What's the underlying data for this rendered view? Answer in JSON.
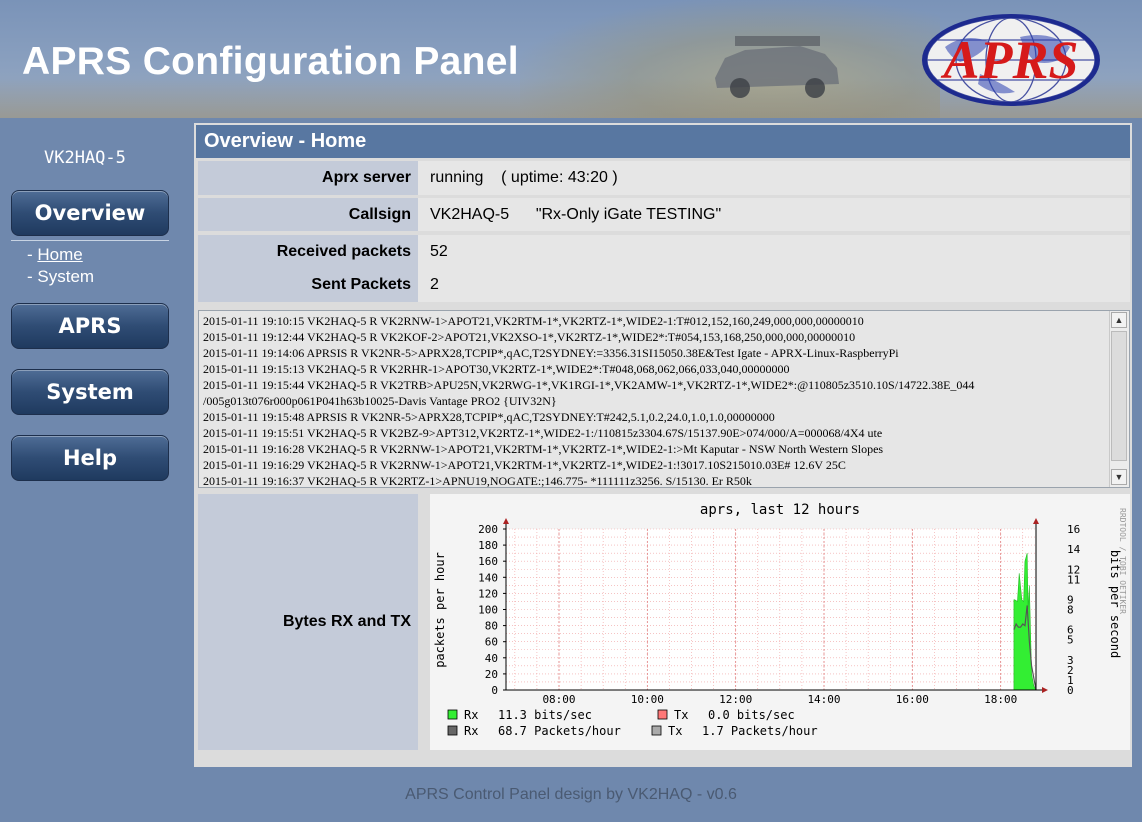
{
  "header": {
    "title": "APRS Configuration Panel",
    "logo_text": "APRS"
  },
  "sidebar": {
    "callsign": "VK2HAQ-5",
    "nav": [
      {
        "label": "Overview"
      },
      {
        "label": "APRS"
      },
      {
        "label": "System"
      },
      {
        "label": "Help"
      }
    ],
    "subnav": {
      "prefix": "- ",
      "home": "Home",
      "system": "System"
    }
  },
  "panel": {
    "title": "Overview - Home",
    "rows": {
      "server_label": "Aprx server",
      "server_value": "running    ( uptime: 43:20 )",
      "callsign_label": "Callsign",
      "callsign_value": "VK2HAQ-5      \"Rx-Only iGate TESTING\"",
      "received_label": "Received packets",
      "received_value": "52",
      "sent_label": "Sent Packets",
      "sent_value": "2"
    }
  },
  "log": [
    "2015-01-11 19:10:15 VK2HAQ-5 R VK2RNW-1>APOT21,VK2RTM-1*,VK2RTZ-1*,WIDE2-1:T#012,152,160,249,000,000,00000010",
    "2015-01-11 19:12:44 VK2HAQ-5 R VK2KOF-2>APOT21,VK2XSO-1*,VK2RTZ-1*,WIDE2*:T#054,153,168,250,000,000,00000010",
    "2015-01-11 19:14:06 APRSIS R VK2NR-5>APRX28,TCPIP*,qAC,T2SYDNEY:=3356.31SI15050.38E&Test Igate - APRX-Linux-RaspberryPi",
    "2015-01-11 19:15:13 VK2HAQ-5 R VK2RHR-1>APOT30,VK2RTZ-1*,WIDE2*:T#048,068,062,066,033,040,00000000",
    "2015-01-11 19:15:44 VK2HAQ-5 R VK2TRB>APU25N,VK2RWG-1*,VK1RGI-1*,VK2AMW-1*,VK2RTZ-1*,WIDE2*:@110805z3510.10S/14722.38E_044",
    "/005g013t076r000p061P041h63b10025-Davis Vantage PRO2 {UIV32N}",
    "2015-01-11 19:15:48 APRSIS R VK2NR-5>APRX28,TCPIP*,qAC,T2SYDNEY:T#242,5.1,0.2,24.0,1.0,1.0,00000000",
    "2015-01-11 19:15:51 VK2HAQ-5 R VK2BZ-9>APT312,VK2RTZ-1*,WIDE2-1:/110815z3304.67S/15137.90E>074/000/A=000068/4X4 ute",
    "2015-01-11 19:16:28 VK2HAQ-5 R VK2RNW-1>APOT21,VK2RTM-1*,VK2RTZ-1*,WIDE2-1:>Mt Kaputar - NSW North Western Slopes",
    "2015-01-11 19:16:29 VK2HAQ-5 R VK2RNW-1>APOT21,VK2RTM-1*,VK2RTZ-1*,WIDE2-1:!3017.10S215010.03E# 12.6V 25C",
    "2015-01-11 19:16:37 VK2HAQ-5 R VK2RTZ-1>APNU19,NOGATE:;146.775- *111111z3256. S/15130. Er R50k"
  ],
  "chart_label": "Bytes RX and TX",
  "chart_data": {
    "type": "area",
    "title": "aprs, last 12 hours",
    "ylabel": "packets per hour",
    "y2label": "bits per second",
    "side_text": "RRDTOOL / TOBI OETIKER",
    "ylim": [
      0,
      200
    ],
    "y2lim": [
      0,
      16
    ],
    "y_ticks": [
      0,
      20,
      40,
      60,
      80,
      100,
      120,
      140,
      160,
      180,
      200
    ],
    "y2_ticks": [
      0,
      1,
      2,
      3,
      5,
      6,
      8,
      9,
      11,
      12,
      14,
      16
    ],
    "xlim": [
      6.8,
      18.8
    ],
    "x_ticks": [
      "08:00",
      "10:00",
      "12:00",
      "14:00",
      "16:00",
      "18:00"
    ],
    "x_tick_hours": [
      8,
      10,
      12,
      14,
      16,
      18
    ],
    "series": [
      {
        "name": "Rx",
        "unit": "bits/sec",
        "color": "#33ee33",
        "x": [
          18.3,
          18.32,
          18.38,
          18.42,
          18.48,
          18.52,
          18.55,
          18.6,
          18.62,
          18.65,
          18.7,
          18.75,
          18.8
        ],
        "values": [
          112,
          112,
          110,
          145,
          112,
          110,
          160,
          170,
          100,
          130,
          20,
          5,
          0
        ]
      },
      {
        "name": "Rx",
        "unit": "Packets/hour",
        "color": "#555555",
        "x": [
          18.3,
          18.35,
          18.4,
          18.45,
          18.5,
          18.55,
          18.6,
          18.65,
          18.7,
          18.8
        ],
        "values": [
          75,
          82,
          78,
          78,
          82,
          80,
          105,
          60,
          30,
          0
        ]
      }
    ],
    "legend": [
      {
        "color": "#33ee33",
        "name": "Rx",
        "value": "11.3 bits/sec"
      },
      {
        "color": "#ff7777",
        "name": "Tx",
        "value": "0.0 bits/sec"
      },
      {
        "color": "#666666",
        "name": "Rx",
        "value": "68.7 Packets/hour"
      },
      {
        "color": "#aaaaaa",
        "name": "Tx",
        "value": "1.7 Packets/hour"
      }
    ]
  },
  "footer": "APRS Control Panel design by VK2HAQ - v0.6"
}
